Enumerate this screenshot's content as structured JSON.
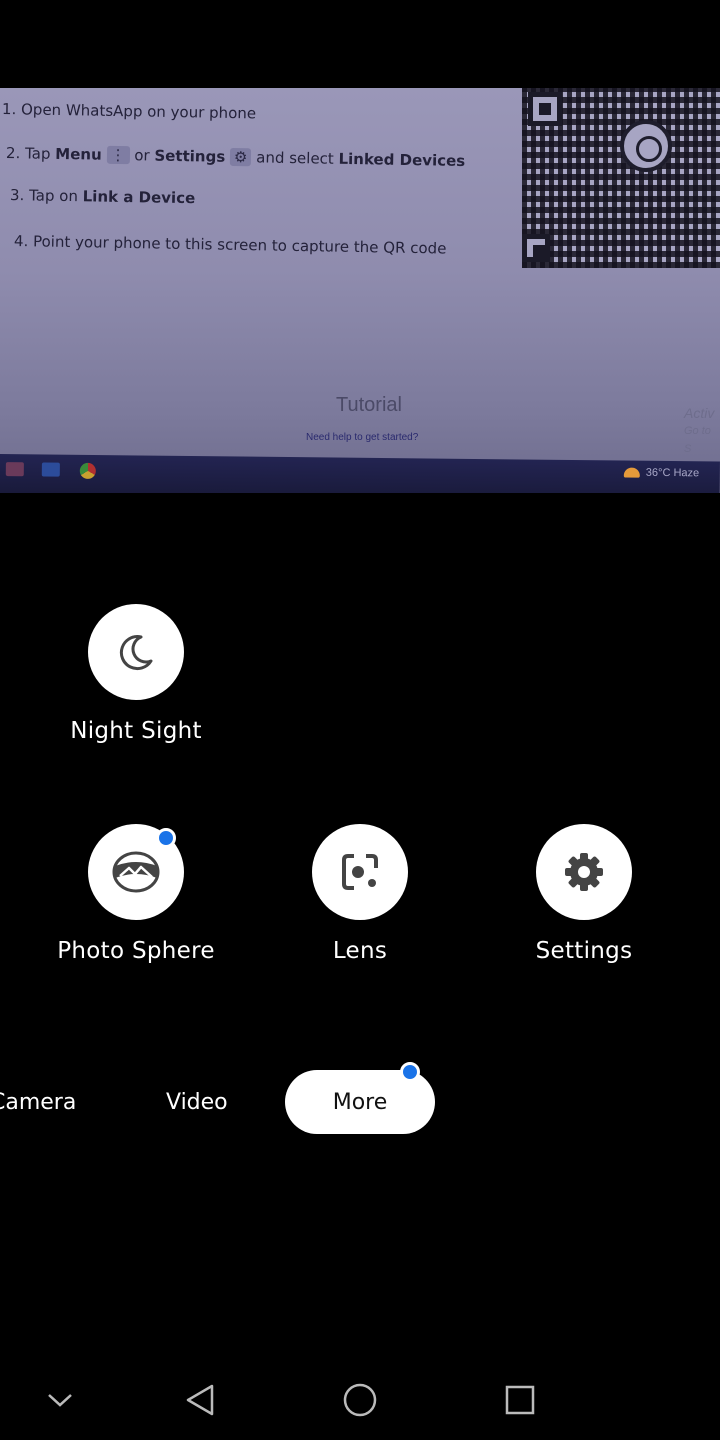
{
  "viewfinder": {
    "steps": [
      "1. Open WhatsApp on your phone",
      "2. Tap",
      "Menu",
      "or",
      "Settings",
      "and select",
      "Linked Devices",
      "3. Tap on",
      "Link a Device",
      "4. Point your phone to this screen to capture the QR code"
    ],
    "tutorial": "Tutorial",
    "help": "Need help to get started?",
    "activate_line1": "Activ",
    "activate_line2": "Go to S",
    "weather": "36°C  Haze"
  },
  "modes": [
    {
      "label": "Night Sight",
      "icon": "moon-icon"
    },
    {
      "label": "Photo Sphere",
      "icon": "photo-sphere-icon",
      "badge": true
    },
    {
      "label": "Lens",
      "icon": "lens-icon"
    },
    {
      "label": "Settings",
      "icon": "gear-icon"
    }
  ],
  "mode_switcher": {
    "camera": "Camera",
    "video": "Video",
    "more": "More",
    "more_badge": true
  },
  "colors": {
    "badge_blue": "#1a73e8",
    "background": "#000000"
  },
  "nav": [
    "chevron-down-icon",
    "back-icon",
    "home-icon",
    "recents-icon"
  ]
}
